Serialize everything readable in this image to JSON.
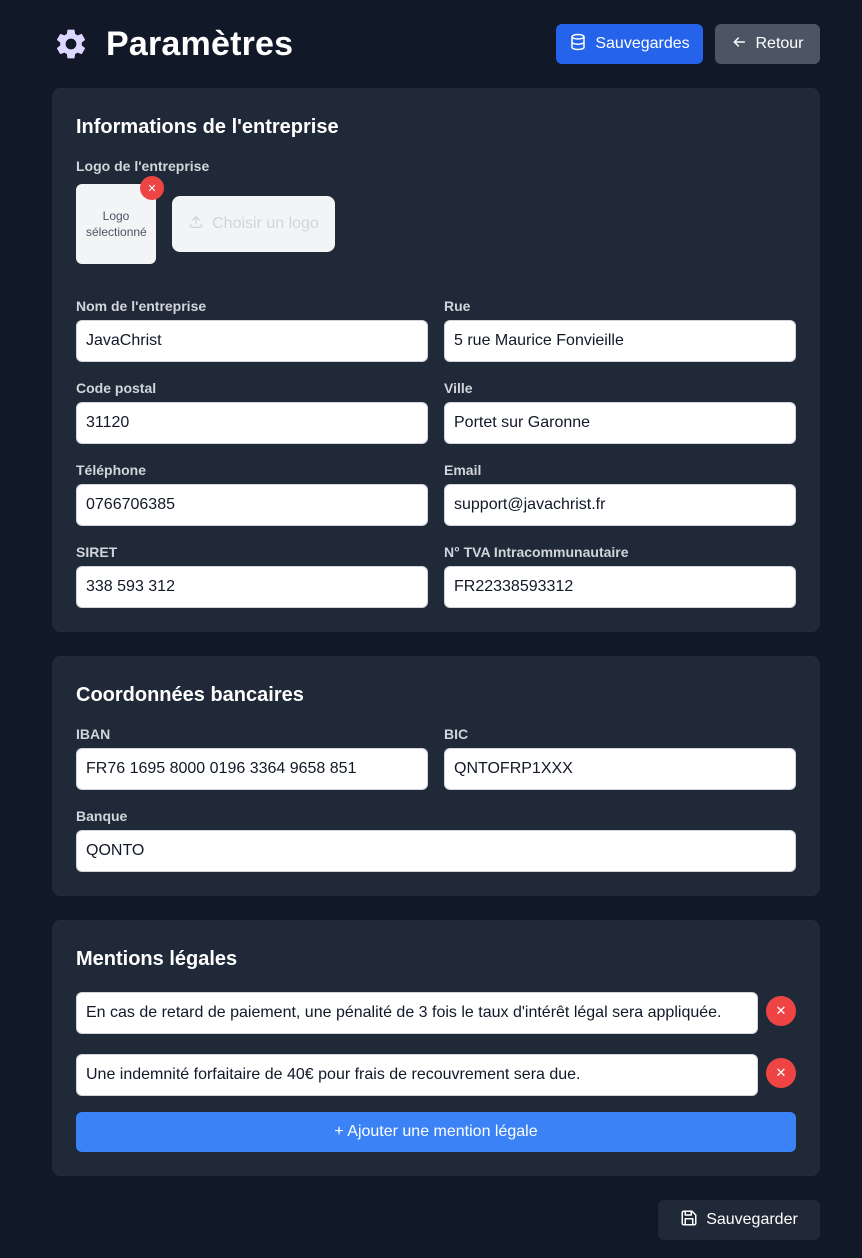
{
  "header": {
    "title": "Paramètres",
    "icon": "gear-icon",
    "backups_label": "Sauvegardes",
    "back_label": "Retour"
  },
  "company": {
    "title": "Informations de l'entreprise",
    "logo_label": "Logo de l'entreprise",
    "logo_preview_text": "Logo sélectionné",
    "choose_logo_label": "Choisir un logo",
    "fields": [
      {
        "label": "Nom de l'entreprise",
        "value": "JavaChrist"
      },
      {
        "label": "Rue",
        "value": "5 rue Maurice Fonvieille"
      },
      {
        "label": "Code postal",
        "value": "31120"
      },
      {
        "label": "Ville",
        "value": "Portet sur Garonne"
      },
      {
        "label": "Téléphone",
        "value": "0766706385"
      },
      {
        "label": "Email",
        "value": "support@javachrist.fr"
      },
      {
        "label": "SIRET",
        "value": "338 593 312"
      },
      {
        "label": "N° TVA Intracommunautaire",
        "value": "FR22338593312"
      }
    ]
  },
  "bank": {
    "title": "Coordonnées bancaires",
    "fields": [
      {
        "label": "IBAN",
        "value": "FR76 1695 8000 0196 3364 9658 851"
      },
      {
        "label": "BIC",
        "value": "QNTOFRP1XXX"
      },
      {
        "label": "Banque",
        "value": "QONTO"
      }
    ]
  },
  "legal": {
    "title": "Mentions légales",
    "mentions": [
      "En cas de retard de paiement, une pénalité de 3 fois le taux d'intérêt légal sera appliquée.",
      "Une indemnité forfaitaire de 40€ pour frais de recouvrement sera due."
    ],
    "add_label": "+ Ajouter une mention légale"
  },
  "footer": {
    "save_label": "Sauvegarder"
  },
  "colors": {
    "background": "#111827",
    "card": "#1f2937",
    "primary": "#2563eb",
    "accent": "#3b82f6",
    "danger": "#ef4444",
    "gear": "#ddd6fe"
  }
}
